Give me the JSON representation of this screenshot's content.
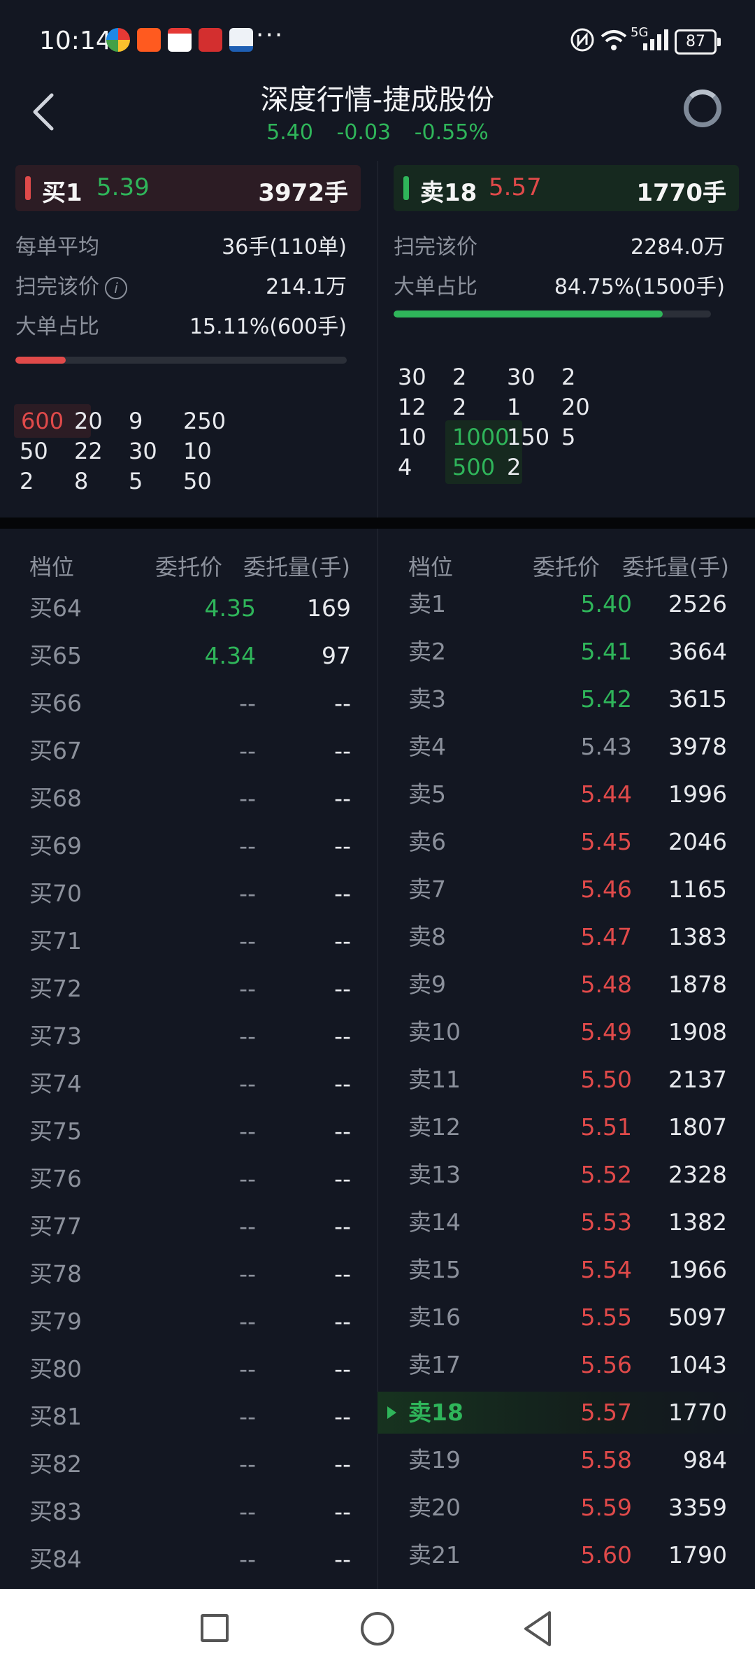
{
  "status_bar": {
    "time": "10:14",
    "more": "···",
    "network": "5G",
    "battery": "87",
    "icons": [
      "browser-app-icon",
      "taobao-app-icon",
      "stock-app-icon",
      "news-app-icon",
      "bank-app-icon",
      "nfc-icon",
      "wifi-icon",
      "signal-icon",
      "battery-icon"
    ]
  },
  "header": {
    "title": "深度行情-捷成股份",
    "price": "5.40",
    "change": "-0.03",
    "change_pct": "-0.55%"
  },
  "buy_summary": {
    "label": "买1",
    "price": "5.39",
    "qty": "3972手",
    "avg_label": "每单平均",
    "avg_value": "36手(110单)",
    "sweep_label": "扫完该价",
    "sweep_value": "214.1万",
    "big_label": "大单占比",
    "big_value": "15.11%(600手)",
    "big_ratio": 0.1511,
    "grid": [
      [
        "600",
        "20",
        "9",
        "250"
      ],
      [
        "50",
        "22",
        "30",
        "10"
      ],
      [
        "2",
        "8",
        "5",
        "50"
      ]
    ]
  },
  "sell_summary": {
    "label": "卖18",
    "price": "5.57",
    "qty": "1770手",
    "sweep_label": "扫完该价",
    "sweep_value": "2284.0万",
    "big_label": "大单占比",
    "big_value": "84.75%(1500手)",
    "big_ratio": 0.8475,
    "grid": [
      [
        "30",
        "2",
        "30",
        "2"
      ],
      [
        "12",
        "2",
        "1",
        "20"
      ],
      [
        "10",
        "1000",
        "150",
        "5"
      ],
      [
        "4",
        "500",
        "2",
        ""
      ]
    ]
  },
  "book_headers": {
    "level": "档位",
    "price": "委托价",
    "qty": "委托量(手)"
  },
  "buy_rows": [
    {
      "level": "买64",
      "price": "4.35",
      "qty": "169"
    },
    {
      "level": "买65",
      "price": "4.34",
      "qty": "97"
    },
    {
      "level": "买66",
      "price": "--",
      "qty": "--"
    },
    {
      "level": "买67",
      "price": "--",
      "qty": "--"
    },
    {
      "level": "买68",
      "price": "--",
      "qty": "--"
    },
    {
      "level": "买69",
      "price": "--",
      "qty": "--"
    },
    {
      "level": "买70",
      "price": "--",
      "qty": "--"
    },
    {
      "level": "买71",
      "price": "--",
      "qty": "--"
    },
    {
      "level": "买72",
      "price": "--",
      "qty": "--"
    },
    {
      "level": "买73",
      "price": "--",
      "qty": "--"
    },
    {
      "level": "买74",
      "price": "--",
      "qty": "--"
    },
    {
      "level": "买75",
      "price": "--",
      "qty": "--"
    },
    {
      "level": "买76",
      "price": "--",
      "qty": "--"
    },
    {
      "level": "买77",
      "price": "--",
      "qty": "--"
    },
    {
      "level": "买78",
      "price": "--",
      "qty": "--"
    },
    {
      "level": "买79",
      "price": "--",
      "qty": "--"
    },
    {
      "level": "买80",
      "price": "--",
      "qty": "--"
    },
    {
      "level": "买81",
      "price": "--",
      "qty": "--"
    },
    {
      "level": "买82",
      "price": "--",
      "qty": "--"
    },
    {
      "level": "买83",
      "price": "--",
      "qty": "--"
    },
    {
      "level": "买84",
      "price": "--",
      "qty": "--"
    }
  ],
  "sell_rows": [
    {
      "level": "卖1",
      "price": "5.40",
      "qty": "2526",
      "color": "green"
    },
    {
      "level": "卖2",
      "price": "5.41",
      "qty": "3664",
      "color": "green"
    },
    {
      "level": "卖3",
      "price": "5.42",
      "qty": "3615",
      "color": "green"
    },
    {
      "level": "卖4",
      "price": "5.43",
      "qty": "3978",
      "color": "gray"
    },
    {
      "level": "卖5",
      "price": "5.44",
      "qty": "1996",
      "color": "red"
    },
    {
      "level": "卖6",
      "price": "5.45",
      "qty": "2046",
      "color": "red"
    },
    {
      "level": "卖7",
      "price": "5.46",
      "qty": "1165",
      "color": "red"
    },
    {
      "level": "卖8",
      "price": "5.47",
      "qty": "1383",
      "color": "red"
    },
    {
      "level": "卖9",
      "price": "5.48",
      "qty": "1878",
      "color": "red"
    },
    {
      "level": "卖10",
      "price": "5.49",
      "qty": "1908",
      "color": "red"
    },
    {
      "level": "卖11",
      "price": "5.50",
      "qty": "2137",
      "color": "red"
    },
    {
      "level": "卖12",
      "price": "5.51",
      "qty": "1807",
      "color": "red"
    },
    {
      "level": "卖13",
      "price": "5.52",
      "qty": "2328",
      "color": "red"
    },
    {
      "level": "卖14",
      "price": "5.53",
      "qty": "1382",
      "color": "red"
    },
    {
      "level": "卖15",
      "price": "5.54",
      "qty": "1966",
      "color": "red"
    },
    {
      "level": "卖16",
      "price": "5.55",
      "qty": "5097",
      "color": "red"
    },
    {
      "level": "卖17",
      "price": "5.56",
      "qty": "1043",
      "color": "red"
    },
    {
      "level": "卖18",
      "price": "5.57",
      "qty": "1770",
      "color": "red",
      "current": true
    },
    {
      "level": "卖19",
      "price": "5.58",
      "qty": "984",
      "color": "red"
    },
    {
      "level": "卖20",
      "price": "5.59",
      "qty": "3359",
      "color": "red"
    },
    {
      "level": "卖21",
      "price": "5.60",
      "qty": "1790",
      "color": "red"
    }
  ],
  "colors": {
    "up": "#e04a4a",
    "down": "#2fb55a",
    "background": "#131722"
  }
}
